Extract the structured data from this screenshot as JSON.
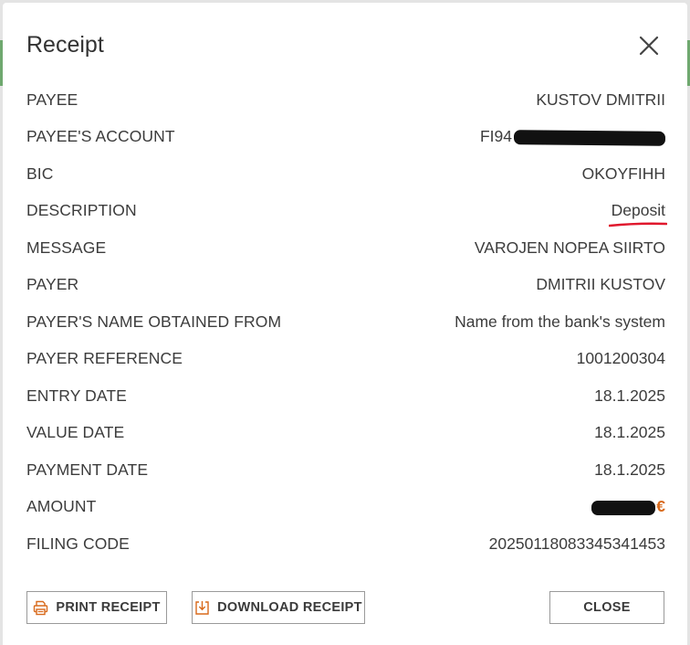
{
  "dialog": {
    "title": "Receipt",
    "close_icon": "close-icon"
  },
  "rows": [
    {
      "label": "PAYEE",
      "value": "KUSTOV DMITRII"
    },
    {
      "label": "PAYEE'S ACCOUNT",
      "value": "FI94"
    },
    {
      "label": "BIC",
      "value": "OKOYFIHH"
    },
    {
      "label": "DESCRIPTION",
      "value": "Deposit"
    },
    {
      "label": "MESSAGE",
      "value": "VAROJEN NOPEA SIIRTO"
    },
    {
      "label": "PAYER",
      "value": "DMITRII KUSTOV"
    },
    {
      "label": "PAYER'S NAME OBTAINED FROM",
      "value": "Name from the bank's system"
    },
    {
      "label": "PAYER REFERENCE",
      "value": "1001200304"
    },
    {
      "label": "ENTRY DATE",
      "value": "18.1.2025"
    },
    {
      "label": "VALUE DATE",
      "value": "18.1.2025"
    },
    {
      "label": "PAYMENT DATE",
      "value": "18.1.2025"
    },
    {
      "label": "AMOUNT",
      "value": "€"
    },
    {
      "label": "FILING CODE",
      "value": "20250118083345341453"
    }
  ],
  "buttons": {
    "print": {
      "label": "PRINT RECEIPT",
      "icon": "printer-icon"
    },
    "download": {
      "label": "DOWNLOAD RECEIPT",
      "icon": "download-icon"
    },
    "close": {
      "label": "CLOSE"
    }
  },
  "colors": {
    "accent_orange": "#d86a1c",
    "annotation_red": "#e0182d",
    "redaction": "#111111",
    "edge_green": "#6fa86f"
  }
}
